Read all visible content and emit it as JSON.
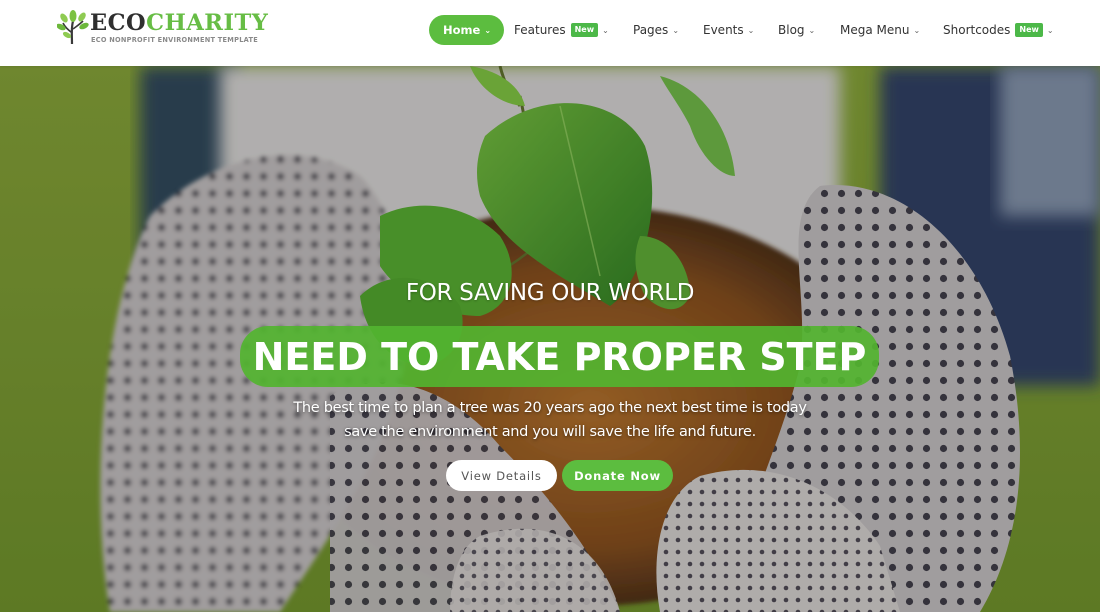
{
  "brand": {
    "name_part1": "ECO",
    "name_part2": "CHARITY",
    "tagline": "ECO NONPROFIT ENVIRONMENT TEMPLATE",
    "logo_icon": "tree-sprout-icon"
  },
  "colors": {
    "accent": "#5cbd3f",
    "badge": "#4cb848",
    "logo_dark": "#2f2f2f",
    "logo_green": "#67bd45"
  },
  "nav": {
    "items": [
      {
        "label": "Home",
        "active": true,
        "badge": null,
        "icon": "chevron-down-icon"
      },
      {
        "label": "Features",
        "active": false,
        "badge": "New",
        "icon": "chevron-down-icon"
      },
      {
        "label": "Pages",
        "active": false,
        "badge": null,
        "icon": "chevron-down-icon"
      },
      {
        "label": "Events",
        "active": false,
        "badge": null,
        "icon": "chevron-down-icon"
      },
      {
        "label": "Blog",
        "active": false,
        "badge": null,
        "icon": "chevron-down-icon"
      },
      {
        "label": "Mega Menu",
        "active": false,
        "badge": null,
        "icon": "chevron-down-icon"
      },
      {
        "label": "Shortcodes",
        "active": false,
        "badge": "New",
        "icon": "chevron-down-icon"
      }
    ],
    "chevron": "⌄"
  },
  "hero": {
    "subtitle": "FOR SAVING OUR WORLD",
    "title": "NEED TO TAKE PROPER STEP",
    "text_line1": "The best time to plan a tree was 20 years ago the next best time is today",
    "text_line2": "save the environment and you will save the life and future.",
    "buttons": {
      "view_details": "View Details",
      "donate_now": "Donate Now"
    },
    "background_image": "hands-in-gloves-holding-seedling-in-soil"
  }
}
